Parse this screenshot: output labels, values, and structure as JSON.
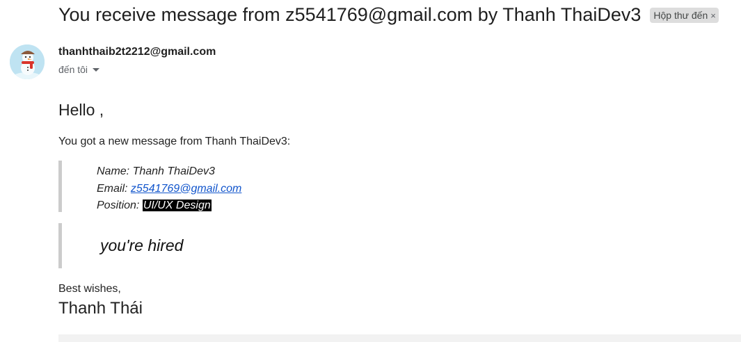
{
  "email": {
    "subject": "You receive message from z5541769@gmail.com by Thanh ThaiDev3",
    "label_chip": "Hộp thư đến",
    "label_close": "×",
    "sender": "thanhthaib2t2212@gmail.com",
    "recipient_text": "đến tôi",
    "avatar_icon": "snowman-avatar-icon"
  },
  "body": {
    "greeting": "Hello ,",
    "intro": "You got a new message from Thanh ThaiDev3:",
    "details": {
      "name_label": "Name: ",
      "name_value": "Thanh ThaiDev3",
      "email_label": "Email: ",
      "email_value": "z5541769@gmail.com",
      "position_label": "Position: ",
      "position_value": "UI/UX Design"
    },
    "message": "you're hired",
    "closing": "Best wishes,",
    "signature": "Thanh Thái"
  },
  "colors": {
    "link": "#1155cc",
    "quote_border": "#cccccc",
    "chip_bg": "#dddddd"
  }
}
